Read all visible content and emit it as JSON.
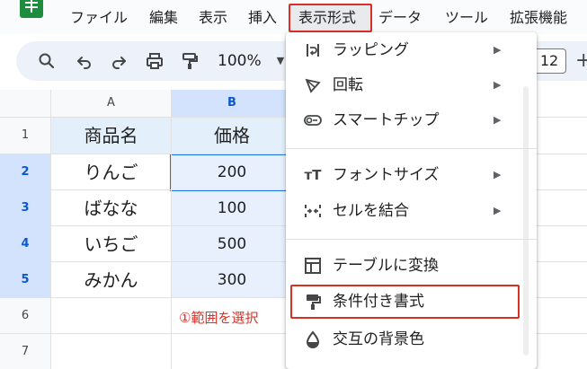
{
  "menubar": {
    "items": [
      "ファイル",
      "編集",
      "表示",
      "挿入",
      "表示形式",
      "データ",
      "ツール",
      "拡張機能"
    ],
    "active": "表示形式"
  },
  "toolbar": {
    "zoom": "100%",
    "font_size": "12",
    "icons": [
      "search-icon",
      "undo-icon",
      "redo-icon",
      "print-icon",
      "paint-format-icon",
      "chevron-down-icon",
      "plus-icon"
    ]
  },
  "sheet": {
    "columns": [
      "A",
      "B"
    ],
    "rows": [
      "1",
      "2",
      "3",
      "4",
      "5",
      "6",
      "7"
    ],
    "selected_column": "B",
    "selected_rows": [
      "2",
      "3",
      "4",
      "5"
    ],
    "header": {
      "a": "商品名",
      "b": "価格"
    },
    "data": [
      {
        "name": "りんご",
        "price": "200"
      },
      {
        "name": "ばなな",
        "price": "100"
      },
      {
        "name": "いちご",
        "price": "500"
      },
      {
        "name": "みかん",
        "price": "300"
      }
    ],
    "annotation": "①範囲を選択"
  },
  "dropdown": {
    "items": [
      {
        "label": "ラッピング",
        "icon": "wrap-icon",
        "submenu": true
      },
      {
        "label": "回転",
        "icon": "rotate-icon",
        "submenu": true
      },
      {
        "label": "スマートチップ",
        "icon": "smart-chip-icon",
        "submenu": true
      },
      {
        "label": "フォントサイズ",
        "icon": "font-size-icon",
        "submenu": true
      },
      {
        "label": "セルを結合",
        "icon": "merge-cells-icon",
        "submenu": true
      },
      {
        "label": "テーブルに変換",
        "icon": "table-icon",
        "submenu": false
      },
      {
        "label": "条件付き書式",
        "icon": "paint-roller-icon",
        "submenu": false
      },
      {
        "label": "交互の背景色",
        "icon": "fill-color-icon",
        "submenu": false
      }
    ],
    "highlighted": "条件付き書式",
    "submenu_glyph": "▶"
  },
  "colors": {
    "highlight_red": "#d93025",
    "selection_blue": "#1a73e8",
    "selection_fill": "#e8f0fe",
    "header_fill": "#e3f0fb"
  }
}
